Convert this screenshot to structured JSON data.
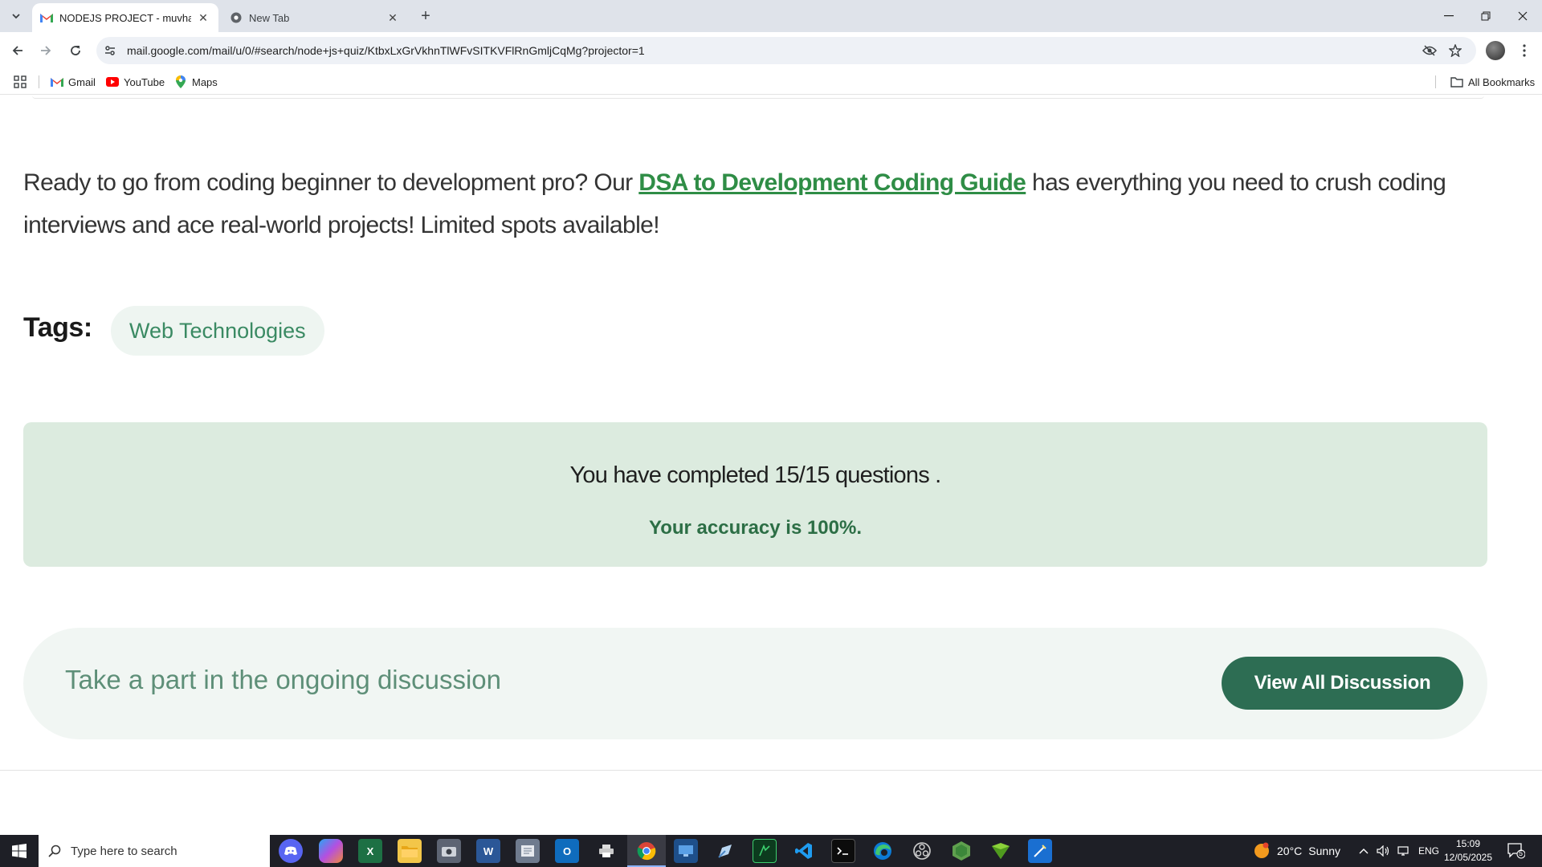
{
  "browser": {
    "tabs": [
      {
        "title": "NODEJS PROJECT - muvhango",
        "favicon": "gmail-icon",
        "active": true
      },
      {
        "title": "New Tab",
        "favicon": "chrome-icon",
        "active": false
      }
    ],
    "url": "mail.google.com/mail/u/0/#search/node+js+quiz/KtbxLxGrVkhnTlWFvSITKVFlRnGmljCqMg?projector=1",
    "bookmarks": [
      {
        "label": "Gmail",
        "icon": "gmail-icon"
      },
      {
        "label": "YouTube",
        "icon": "youtube-icon"
      },
      {
        "label": "Maps",
        "icon": "maps-icon"
      }
    ],
    "all_bookmarks": "All Bookmarks"
  },
  "page": {
    "promo_before": "Ready to go from coding beginner to development pro? Our ",
    "promo_link": "DSA to Development Coding Guide",
    "promo_after": " has everything you need to crush coding interviews and ace real-world projects! Limited spots available!",
    "tags_label": "Tags:",
    "tags": [
      "Web Technologies"
    ],
    "result_text": "You have completed 15/15 questions .",
    "accuracy_text": "Your accuracy is 100%.",
    "discussion_text": "Take a part in the ongoing discussion",
    "discussion_button": "View All Discussion"
  },
  "taskbar": {
    "search_placeholder": "Type here to search",
    "weather_temp": "20°C",
    "weather_desc": "Sunny",
    "language": "ENG",
    "time": "15:09",
    "date": "12/05/2025",
    "notification_count": "5",
    "apps": [
      "discord-icon",
      "copilot-icon",
      "excel-icon",
      "file-explorer-icon",
      "camera-icon",
      "word-icon",
      "notepad-icon",
      "outlook-icon",
      "printer-icon",
      "chrome-icon",
      "remote-desktop-icon",
      "pen-icon",
      "spreadsheet-icon",
      "vscode-icon",
      "terminal-icon",
      "edge-icon",
      "obs-icon",
      "nodejs-icon",
      "greenapp-icon",
      "paint-icon"
    ]
  },
  "colors": {
    "accent_green": "#2f8d46",
    "button_green": "#2d6d53",
    "result_bg": "#dcebdf"
  }
}
